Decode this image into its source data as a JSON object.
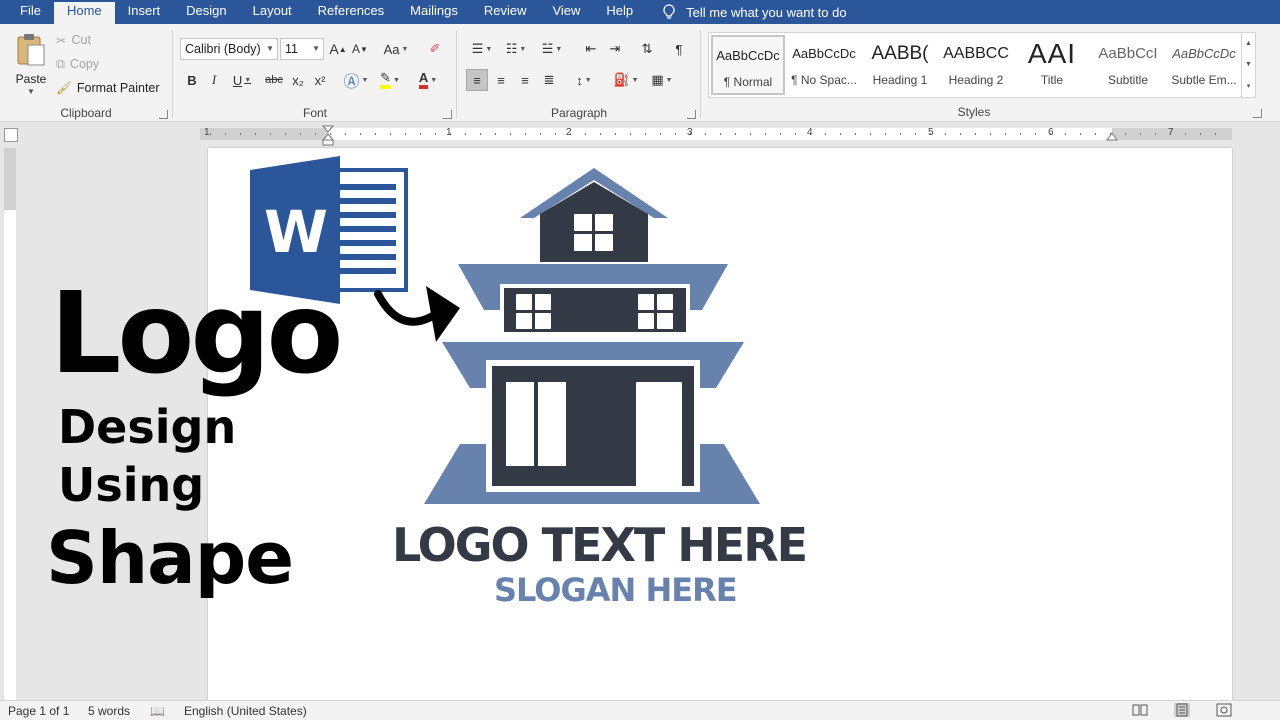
{
  "menu": {
    "tabs": [
      "File",
      "Home",
      "Insert",
      "Design",
      "Layout",
      "References",
      "Mailings",
      "Review",
      "View",
      "Help"
    ],
    "active_tab": "Home",
    "tell_me": "Tell me what you want to do"
  },
  "clipboard": {
    "paste": "Paste",
    "cut": "Cut",
    "copy": "Copy",
    "format_painter": "Format Painter",
    "label": "Clipboard"
  },
  "font": {
    "family": "Calibri (Body)",
    "size": "11",
    "label": "Font",
    "bold": "B",
    "italic": "I",
    "underline": "U",
    "strikethrough": "abc",
    "subscript": "x₂",
    "superscript": "x²",
    "grow": "A",
    "shrink": "A",
    "case": "Aa"
  },
  "paragraph": {
    "label": "Paragraph"
  },
  "styles": {
    "label": "Styles",
    "items": [
      {
        "sample": "AaBbCcDc",
        "name": "¶ Normal"
      },
      {
        "sample": "AaBbCcDc",
        "name": "¶ No Spac..."
      },
      {
        "sample": "AABB(",
        "name": "Heading 1"
      },
      {
        "sample": "AABBCC",
        "name": "Heading 2"
      },
      {
        "sample": "AAI",
        "name": "Title"
      },
      {
        "sample": "AaBbCcI",
        "name": "Subtitle"
      },
      {
        "sample": "AaBbCcDc",
        "name": "Subtle Em..."
      }
    ]
  },
  "ruler": {
    "numbers": [
      "1",
      "1",
      "2",
      "3",
      "4",
      "5",
      "6",
      "7"
    ]
  },
  "overlay": {
    "line1": "Logo",
    "line2": "Design",
    "line3": "Using",
    "line4": "Shape"
  },
  "logo": {
    "text": "LOGO TEXT HERE",
    "slogan": "SLOGAN HERE",
    "word_letter": "W",
    "dark_color": "#333a45",
    "light_color": "#6682ad"
  },
  "colors": {
    "word_blue": "#2b579a",
    "ribbon": "#f3f3f3"
  },
  "status": {
    "page": "Page 1 of 1",
    "words": "5 words",
    "language": "English (United States)"
  }
}
